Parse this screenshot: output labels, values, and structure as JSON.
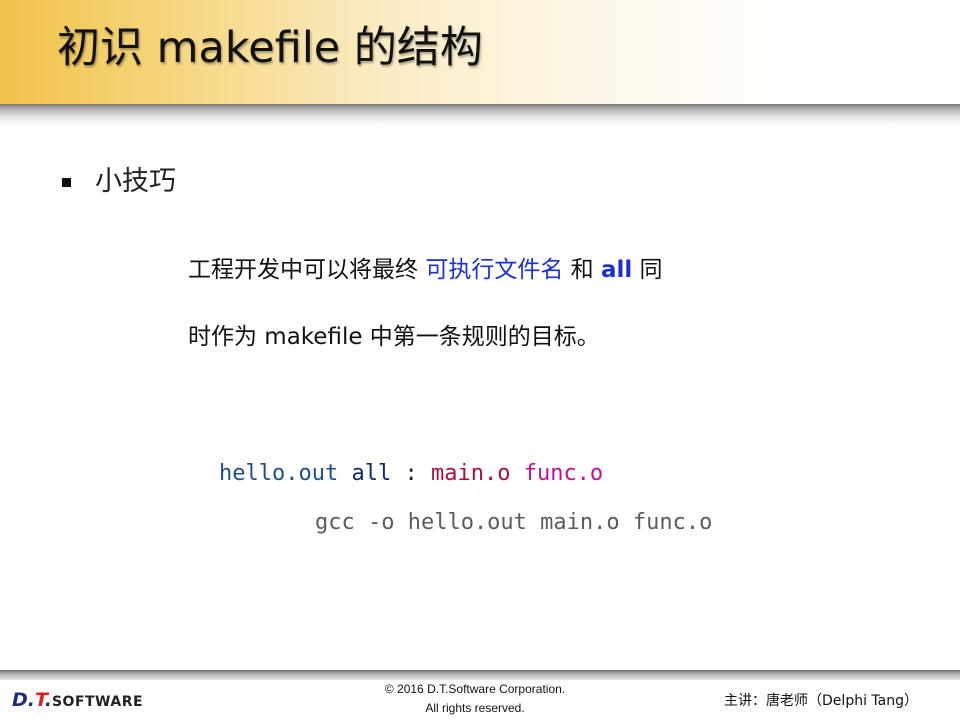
{
  "slide": {
    "title": "初识 makefile 的结构",
    "bullet": "小技巧"
  },
  "paragraph": {
    "line1_prefix": "工程开发中可以将最终 ",
    "line1_highlight1": "可执行文件名",
    "line1_mid": " 和 ",
    "line1_highlight2": "all",
    "line1_suffix": " 同",
    "line2": "时作为 makefile 中第一条规则的目标。"
  },
  "code": {
    "target": "hello.out",
    "all": "all",
    "colon": ":",
    "dep1": "main.o",
    "dep2": "func.o",
    "command": "gcc -o hello.out main.o func.o"
  },
  "footer": {
    "logo_dt": "D.",
    "logo_t": "T",
    "logo_dot": ".",
    "logo_software": "SOFTWARE",
    "copyright_line1": "© 2016 D.T.Software Corporation.",
    "copyright_line2": "All rights reserved.",
    "lecturer": "主讲：唐老师（Delphi Tang）"
  },
  "colors": {
    "title_gradient_start": "#f2c24a",
    "highlight_blue": "#1a2fd6",
    "code_target": "#1f4e8c",
    "code_dep1": "#a8123a",
    "code_dep2": "#c0109a"
  }
}
